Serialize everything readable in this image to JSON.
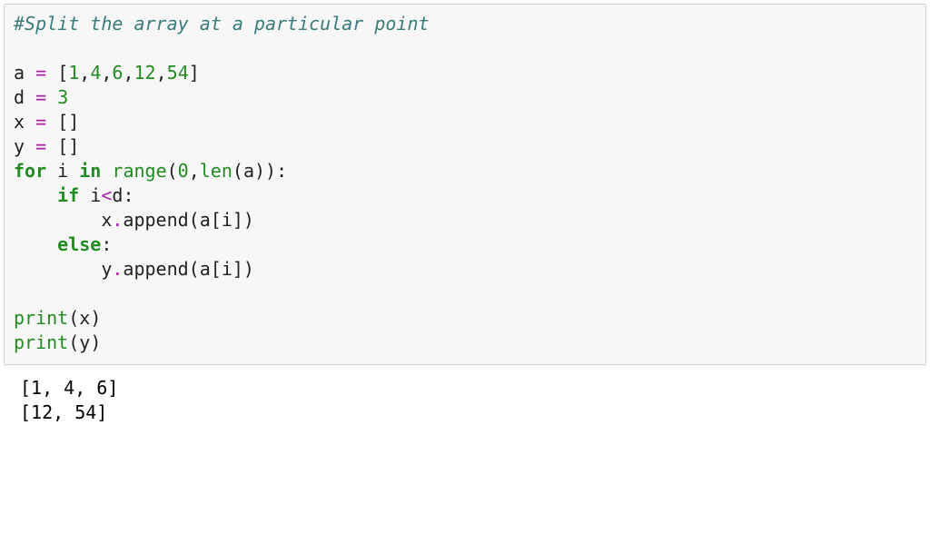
{
  "code": {
    "line1": {
      "comment": "#Split the array at a particular point"
    },
    "line3": {
      "var_a": "a",
      "sp1": " ",
      "eq": "=",
      "sp2": " ",
      "lb": "[",
      "n1": "1",
      "c1": ",",
      "n2": "4",
      "c2": ",",
      "n3": "6",
      "c3": ",",
      "n4": "12",
      "c4": ",",
      "n5": "54",
      "rb": "]"
    },
    "line4": {
      "var_d": "d",
      "sp1": " ",
      "eq": "=",
      "sp2": " ",
      "n": "3"
    },
    "line5": {
      "var_x": "x",
      "sp1": " ",
      "eq": "=",
      "sp2": " ",
      "lb": "[",
      "rb": "]"
    },
    "line6": {
      "var_y": "y",
      "sp1": " ",
      "eq": "=",
      "sp2": " ",
      "lb": "[",
      "rb": "]"
    },
    "line7": {
      "kw_for": "for",
      "sp1": " ",
      "var_i": "i",
      "sp2": " ",
      "kw_in": "in",
      "sp3": " ",
      "fn_range": "range",
      "lp": "(",
      "n0": "0",
      "c": ",",
      "fn_len": "len",
      "lp2": "(",
      "var_a": "a",
      "rp2": ")",
      "rp": ")",
      "colon": ":"
    },
    "line8": {
      "indent": "    ",
      "kw_if": "if",
      "sp1": " ",
      "var_i": "i",
      "lt": "<",
      "var_d": "d",
      "colon": ":"
    },
    "line9": {
      "indent": "        ",
      "var_x": "x",
      "dot": ".",
      "method": "append",
      "lp": "(",
      "var_a": "a",
      "lb": "[",
      "var_i": "i",
      "rb": "]",
      "rp": ")"
    },
    "line10": {
      "indent": "    ",
      "kw_else": "else",
      "colon": ":"
    },
    "line11": {
      "indent": "        ",
      "var_y": "y",
      "dot": ".",
      "method": "append",
      "lp": "(",
      "var_a": "a",
      "lb": "[",
      "var_i": "i",
      "rb": "]",
      "rp": ")"
    },
    "line13": {
      "fn_print": "print",
      "lp": "(",
      "var_x": "x",
      "rp": ")"
    },
    "line14": {
      "fn_print": "print",
      "lp": "(",
      "var_y": "y",
      "rp": ")"
    }
  },
  "output": {
    "line1": "[1, 4, 6]",
    "line2": "[12, 54]"
  }
}
